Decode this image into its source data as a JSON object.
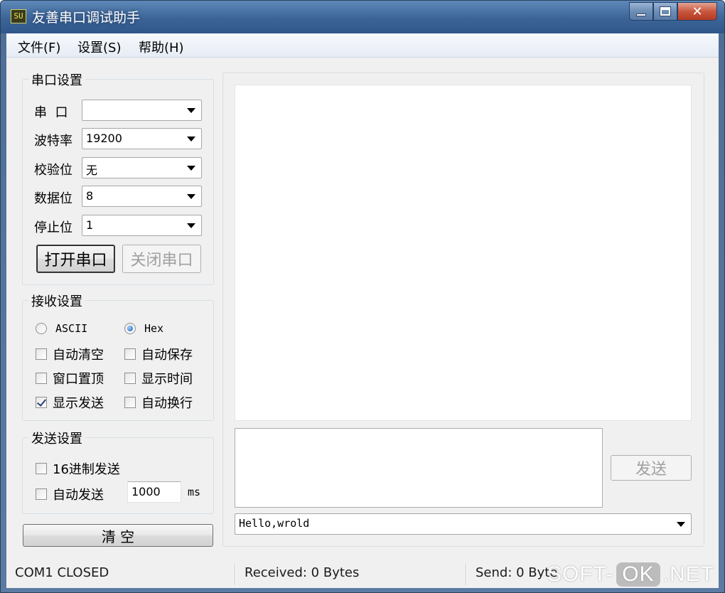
{
  "window": {
    "title": "友善串口调试助手",
    "app_icon": "SU"
  },
  "menu": {
    "items": [
      "文件(F)",
      "设置(S)",
      "帮助(H)"
    ]
  },
  "serial_settings": {
    "title": "串口设置",
    "fields": [
      {
        "label": "串  口",
        "value": ""
      },
      {
        "label": "波特率",
        "value": "19200"
      },
      {
        "label": "校验位",
        "value": "无"
      },
      {
        "label": "数据位",
        "value": "8"
      },
      {
        "label": "停止位",
        "value": "1"
      }
    ],
    "open_button": "打开串口",
    "close_button": "关闭串口"
  },
  "receive_settings": {
    "title": "接收设置",
    "radio_ascii": "ASCII",
    "radio_hex": "Hex",
    "selected": "Hex",
    "options": [
      {
        "label": "自动清空",
        "checked": false
      },
      {
        "label": "自动保存",
        "checked": false
      },
      {
        "label": "窗口置顶",
        "checked": false
      },
      {
        "label": "显示时间",
        "checked": false
      },
      {
        "label": "显示发送",
        "checked": true
      },
      {
        "label": "自动换行",
        "checked": false
      }
    ]
  },
  "send_settings": {
    "title": "发送设置",
    "hex_send": "16进制发送",
    "auto_send": "自动发送",
    "interval": "1000",
    "unit": "ms"
  },
  "clear_button": "清 空",
  "send_button": "发送",
  "send_history": "Hello,wrold",
  "status": {
    "port": "COM1 CLOSED",
    "received": "Received: 0 Bytes",
    "send": "Send: 0 Byte"
  },
  "watermark": {
    "left": "SOFT-",
    "mid": "OK",
    "right": ".NET"
  }
}
